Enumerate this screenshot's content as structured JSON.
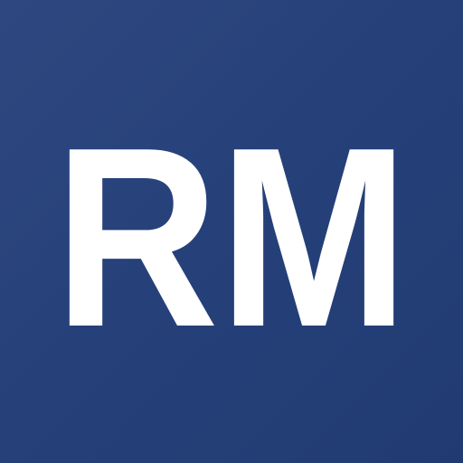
{
  "icon": {
    "monogram": "RM",
    "background_color_start": "#2f4780",
    "background_color_end": "#213b72",
    "text_color": "#ffffff"
  }
}
